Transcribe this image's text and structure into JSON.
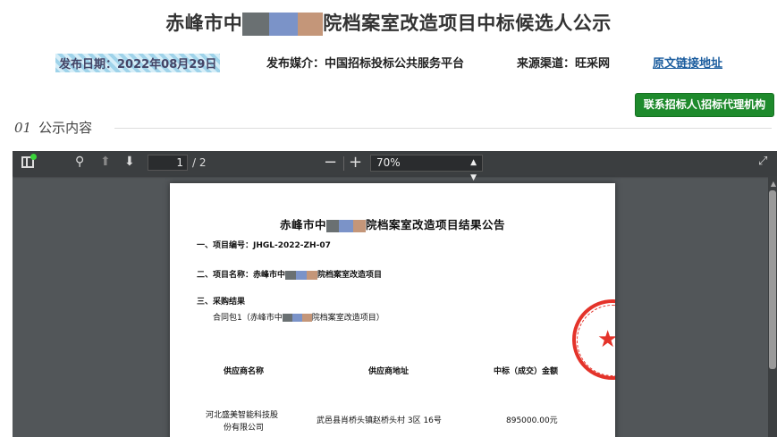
{
  "header": {
    "title_prefix": "赤峰市中",
    "title_suffix": "院档案室改造项目中标候选人公示"
  },
  "meta": {
    "date": "发布日期：2022年08月29日",
    "media": "发布媒介：中国招标投标公共服务平台",
    "source": "来源渠道：旺采网",
    "link_label": "原文链接地址"
  },
  "contact_button": "联系招标人\\招标代理机构",
  "section": {
    "number": "01",
    "label": "公示内容"
  },
  "viewer": {
    "page_current": "1",
    "page_total": "/ 2",
    "zoom": "70%"
  },
  "document": {
    "title_prefix": "赤峰市中",
    "title_suffix": "院档案室改造项目结果公告",
    "item1": "一、项目编号：JHGL-2022-ZH-07",
    "item2_prefix": "二、项目名称：赤峰市中",
    "item2_suffix": "院档案室改造项目",
    "item3": "三、采购结果",
    "package_prefix": "合同包1（赤峰市中",
    "package_suffix": "院档案室改造项目）",
    "columns": [
      "供应商名称",
      "供应商地址",
      "中标（成交）金额"
    ],
    "rows": [
      {
        "name_line1": "河北盛美智能科技股",
        "name_line2": "份有限公司",
        "address": "武邑县肖桥头镇赵桥头村 3区 16号",
        "amount": "895000.00元"
      }
    ]
  }
}
